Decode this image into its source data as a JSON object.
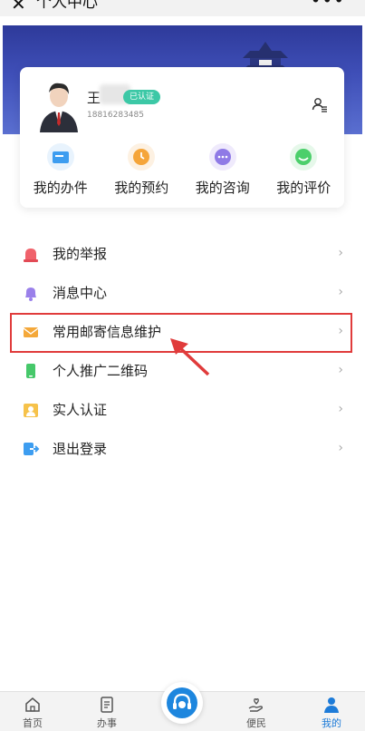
{
  "header": {
    "title": "个人中心",
    "close_glyph": "✕",
    "more_glyph": "•••"
  },
  "profile": {
    "name": "王",
    "badge": "已认证",
    "phone": "18816283485"
  },
  "quick_actions": [
    {
      "label": "我的办件",
      "icon": "folder-icon",
      "color": "#3d9df0"
    },
    {
      "label": "我的预约",
      "icon": "clock-icon",
      "color": "#f5a53a"
    },
    {
      "label": "我的咨询",
      "icon": "chat-icon",
      "color": "#8f7ae6"
    },
    {
      "label": "我的评价",
      "icon": "rating-icon",
      "color": "#4ccf6b"
    }
  ],
  "menu": [
    {
      "label": "我的举报",
      "icon": "alarm-icon"
    },
    {
      "label": "消息中心",
      "icon": "bell-icon"
    },
    {
      "label": "常用邮寄信息维护",
      "icon": "mail-icon"
    },
    {
      "label": "个人推广二维码",
      "icon": "phone-icon"
    },
    {
      "label": "实人认证",
      "icon": "person-icon"
    },
    {
      "label": "退出登录",
      "icon": "logout-icon"
    }
  ],
  "chevron": "›",
  "tabs": [
    {
      "label": "首页",
      "icon": "home-icon"
    },
    {
      "label": "办事",
      "icon": "document-icon"
    },
    {
      "label": "便民",
      "icon": "hand-heart-icon"
    },
    {
      "label": "我的",
      "icon": "user-icon",
      "active": true
    }
  ],
  "colors": {
    "accent": "#1d86de",
    "badge": "#3cc8a6",
    "highlight": "#e03b3b"
  }
}
